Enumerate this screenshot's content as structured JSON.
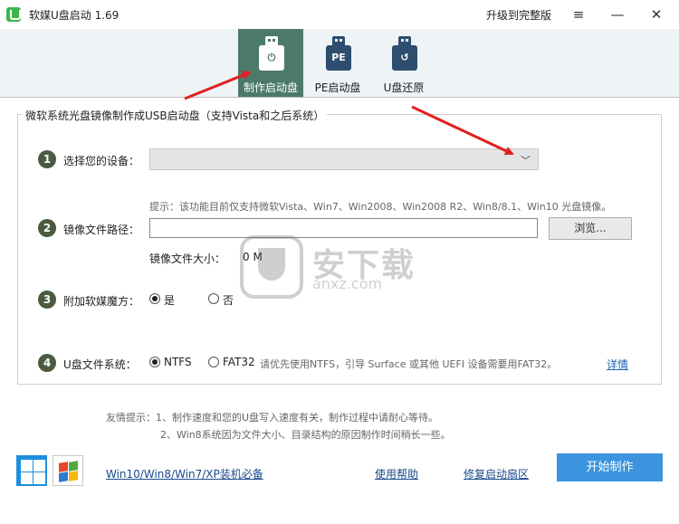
{
  "titlebar": {
    "app_title": "软媒U盘启动 1.69",
    "upgrade_label": "升级到完整版",
    "menu_glyph": "≡",
    "minimize_glyph": "—",
    "close_glyph": "✕"
  },
  "toolbar": {
    "tools": [
      {
        "label": "制作启动盘",
        "active": true
      },
      {
        "label": "PE启动盘",
        "active": false,
        "icon_text": "PE"
      },
      {
        "label": "U盘还原",
        "active": false
      }
    ]
  },
  "form": {
    "group_title": "微软系统光盘镜像制作成USB启动盘（支持Vista和之后系统）",
    "step1": {
      "num": "1",
      "label": "选择您的设备："
    },
    "step2": {
      "num": "2",
      "label": "镜像文件路径：",
      "hint": "提示：该功能目前仅支持微软Vista、Win7、Win2008、Win2008 R2、Win8/8.1、Win10 光盘镜像。",
      "path_value": "",
      "browse_label": "浏览...",
      "size_label": "镜像文件大小：",
      "size_value": "0 M"
    },
    "step3": {
      "num": "3",
      "label": "附加软媒魔方：",
      "yes": "是",
      "no": "否",
      "selected": "yes"
    },
    "step4": {
      "num": "4",
      "label": "U盘文件系统：",
      "opt1": "NTFS",
      "opt2": "FAT32",
      "selected": "NTFS",
      "note": "请优先使用NTFS，引导 Surface 或其他 UEFI 设备需要用FAT32。",
      "detail_link": "详情"
    }
  },
  "tips": {
    "line1": "友情提示：1、制作速度和您的U盘写入速度有关，制作过程中请耐心等待。",
    "line2": "2、Win8系统因为文件大小、目录结构的原因制作时间稍长一些。"
  },
  "footer": {
    "link_systems": "Win10/Win8/Win7/XP装机必备",
    "link_help": "使用帮助",
    "link_repair": "修复启动扇区",
    "start_button": "开始制作"
  },
  "watermark": {
    "text": "安下载",
    "sub": "anxz.com"
  },
  "colors": {
    "accent": "#3b94dd",
    "active_tab": "#4c7a6a",
    "step_circle": "#4b5b42",
    "link": "#1a4a8c",
    "arrow": "#e02020"
  }
}
